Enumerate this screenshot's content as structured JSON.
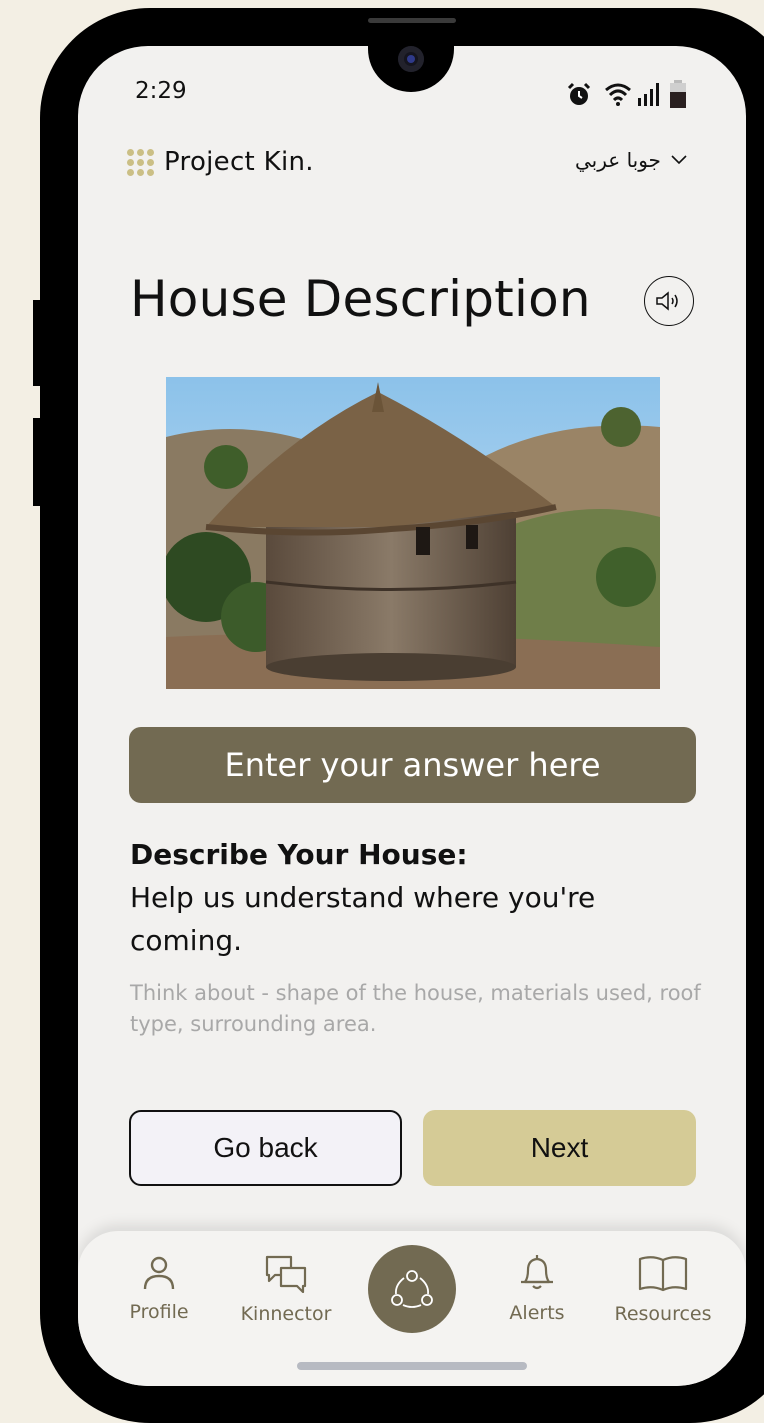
{
  "status_bar": {
    "time": "2:29"
  },
  "header": {
    "brand_name": "Project Kin.",
    "language": "جوبا عربي"
  },
  "page": {
    "title": "House Description",
    "answer_button_label": "Enter your answer here",
    "prompt_heading": "Describe Your House:",
    "prompt_body": "Help us understand where you're coming.",
    "hint": "Think about - shape of the house, materials used, roof type, surrounding area."
  },
  "actions": {
    "back_label": "Go back",
    "next_label": "Next"
  },
  "tabbar": {
    "items": [
      {
        "label": "Profile",
        "icon": "person-icon"
      },
      {
        "label": "Kinnector",
        "icon": "chat-bubbles-icon"
      },
      {
        "label": "",
        "icon": "share-network-icon"
      },
      {
        "label": "Alerts",
        "icon": "bell-icon"
      },
      {
        "label": "Resources",
        "icon": "book-icon"
      }
    ]
  },
  "colors": {
    "accent": "#726a52",
    "next_button": "#d5cb96",
    "background": "#f2f1ef",
    "hint_text": "#a8a8a8"
  }
}
